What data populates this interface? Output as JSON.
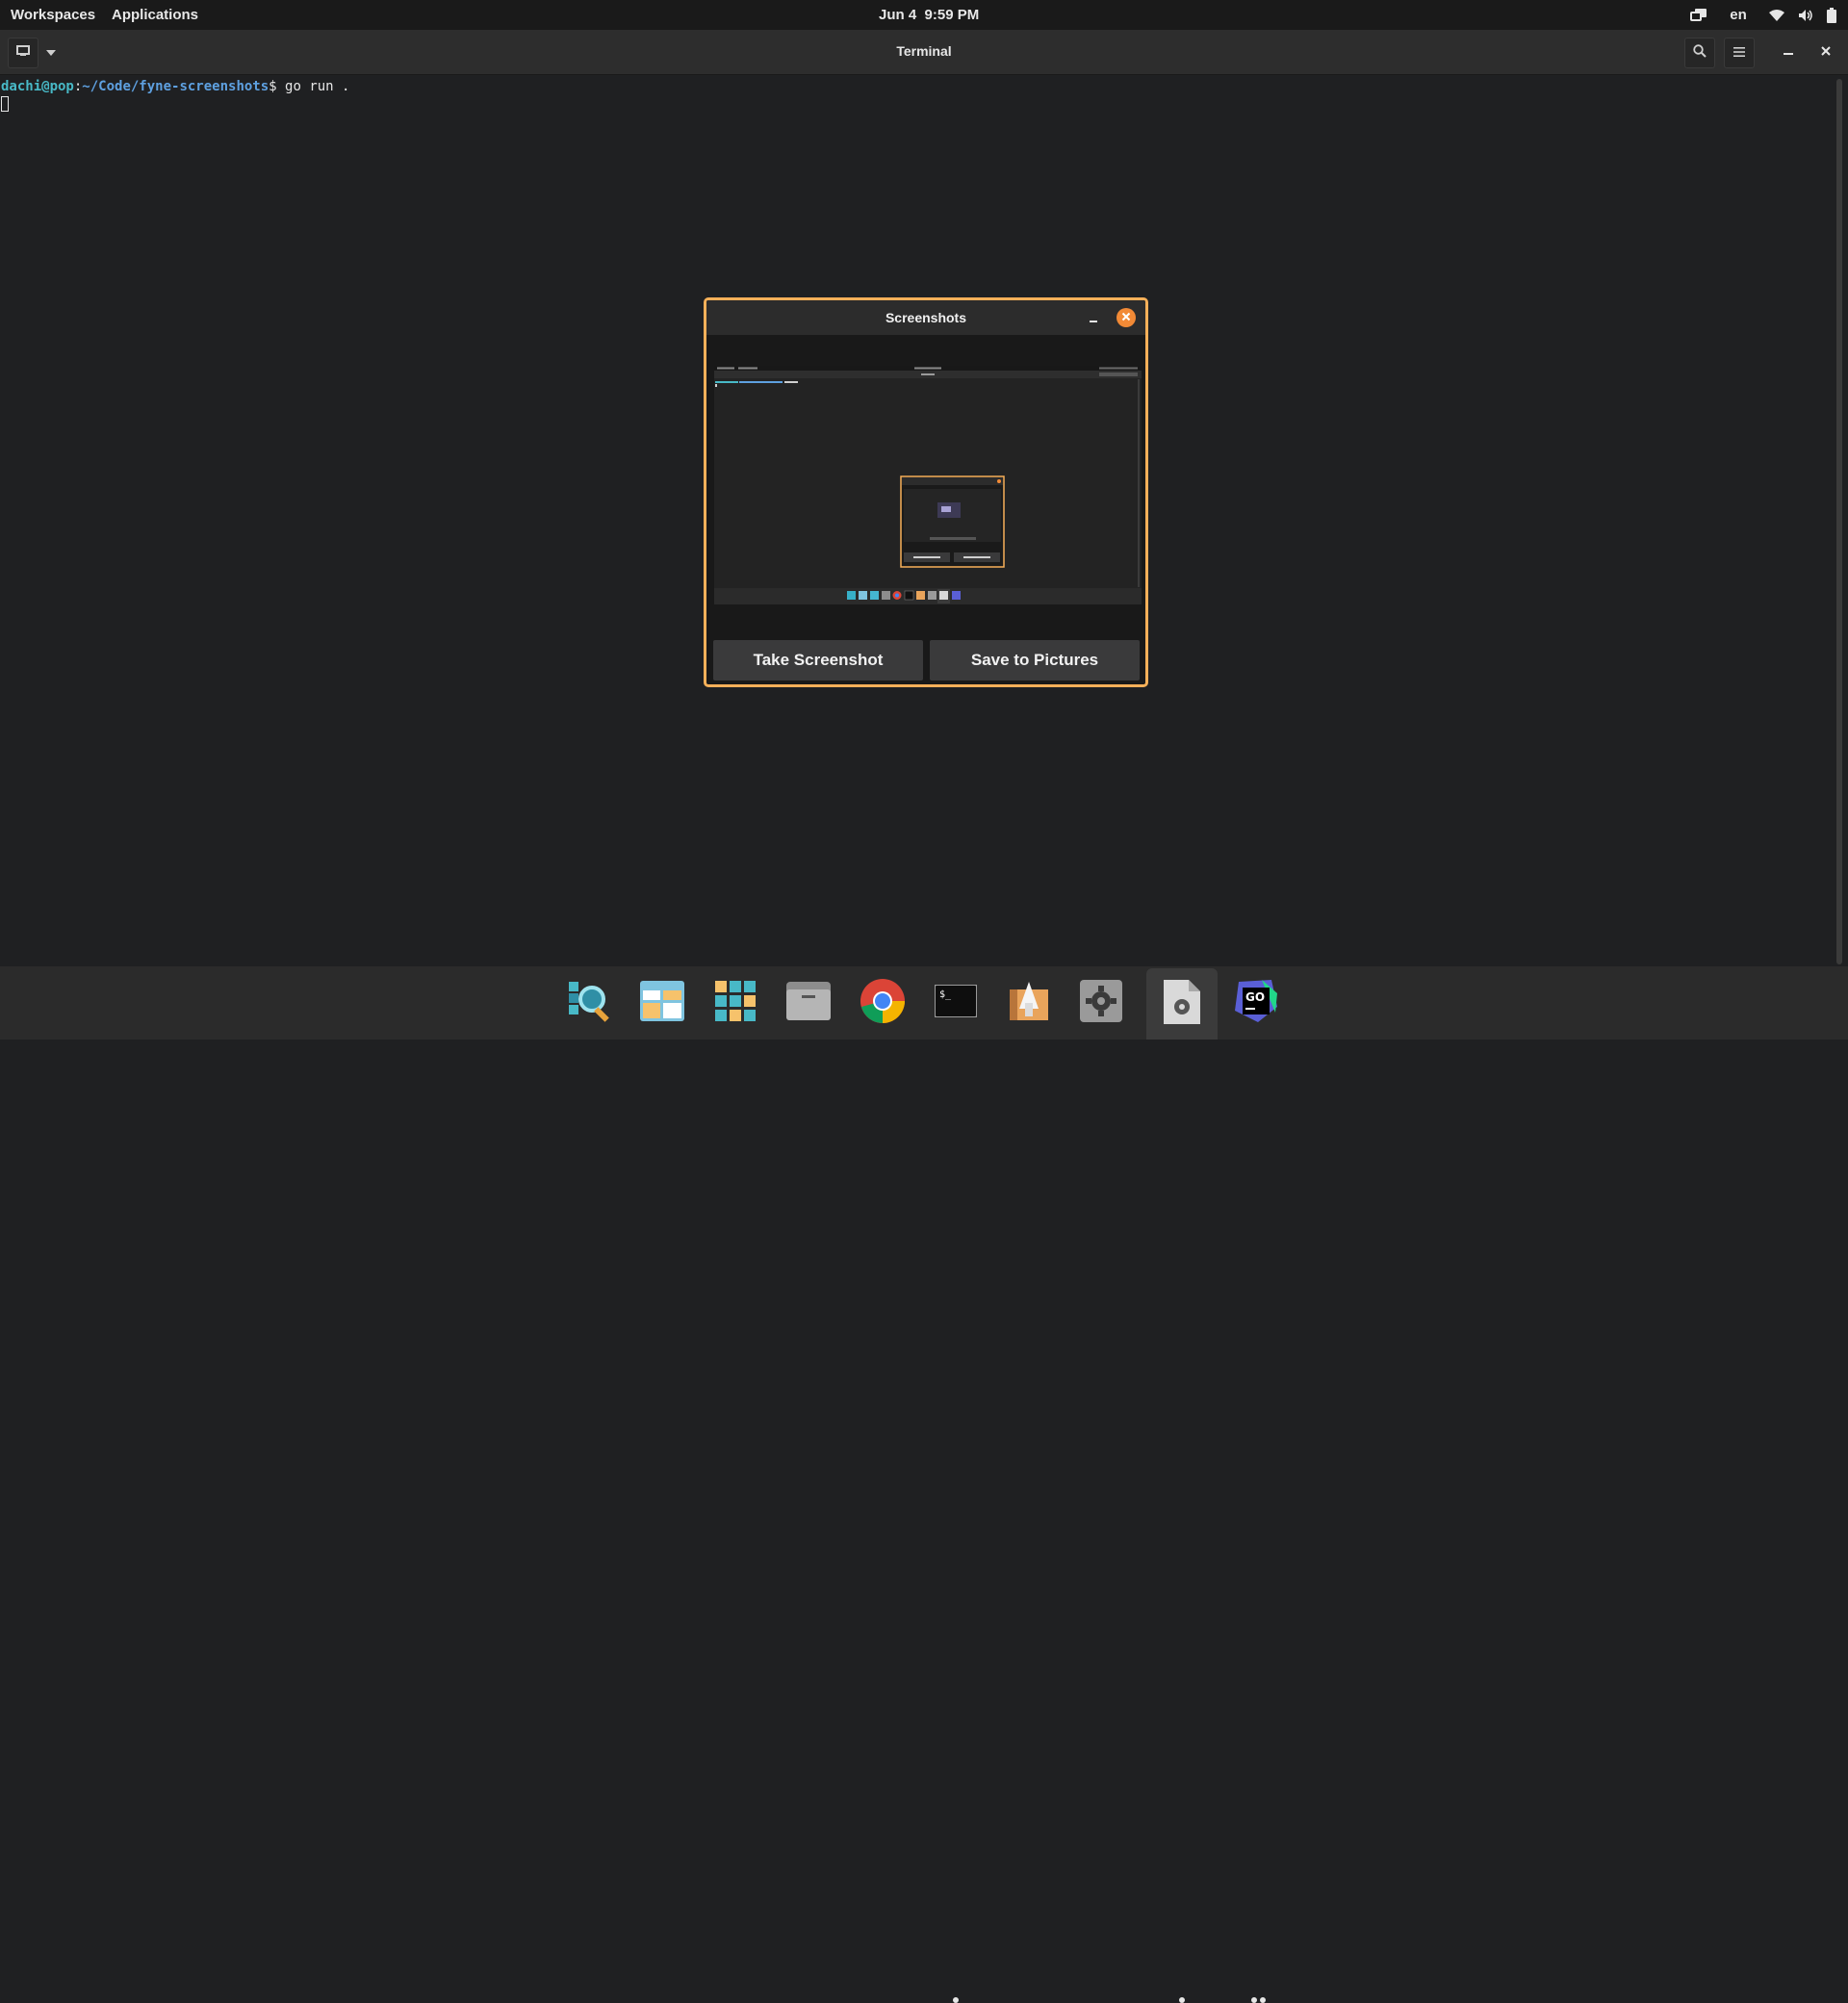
{
  "topbar": {
    "workspaces": "Workspaces",
    "applications": "Applications",
    "date": "Jun 4",
    "time": "9:59 PM",
    "lang": "en",
    "icons": [
      "display-icon",
      "wifi-icon",
      "volume-icon",
      "battery-icon"
    ]
  },
  "terminal": {
    "title": "Terminal",
    "prompt_user": "dachi@pop",
    "prompt_sep": ":",
    "prompt_path": "~/Code/fyne-screenshots",
    "prompt_dollar": "$ ",
    "command": "go run ."
  },
  "dialog": {
    "title": "Screenshots",
    "take_label": "Take Screenshot",
    "save_label": "Save to Pictures",
    "accent": "#f7b059",
    "close_color": "#f28a36"
  },
  "dock": {
    "items": [
      "search-app",
      "files-manager",
      "app-grid",
      "file-folder",
      "chrome",
      "terminal",
      "installer",
      "settings",
      "system-doc",
      "goland"
    ],
    "running": [
      "terminal",
      "system-doc",
      "goland"
    ]
  }
}
